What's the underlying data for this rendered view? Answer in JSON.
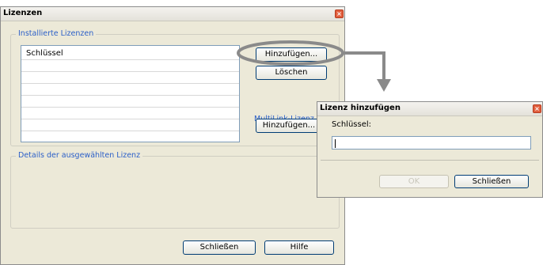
{
  "main_dialog": {
    "title": "Lizenzen",
    "installed_group_label": "Installierte Lizenzen",
    "list_header": "Schlüssel",
    "add_button": "Hinzufügen...",
    "delete_button": "Löschen",
    "multilink_label": "MultiLink-Lizenz",
    "multilink_add_button": "Hinzufügen...",
    "details_group_label": "Details der ausgewählten Lizenz",
    "close_button": "Schließen",
    "help_button": "Hilfe"
  },
  "add_dialog": {
    "title": "Lizenz hinzufügen",
    "key_label": "Schlüssel:",
    "key_value": "",
    "ok_button": "OK",
    "close_button": "Schließen"
  },
  "annotation": {
    "highlight_color": "#8a8a8a"
  }
}
